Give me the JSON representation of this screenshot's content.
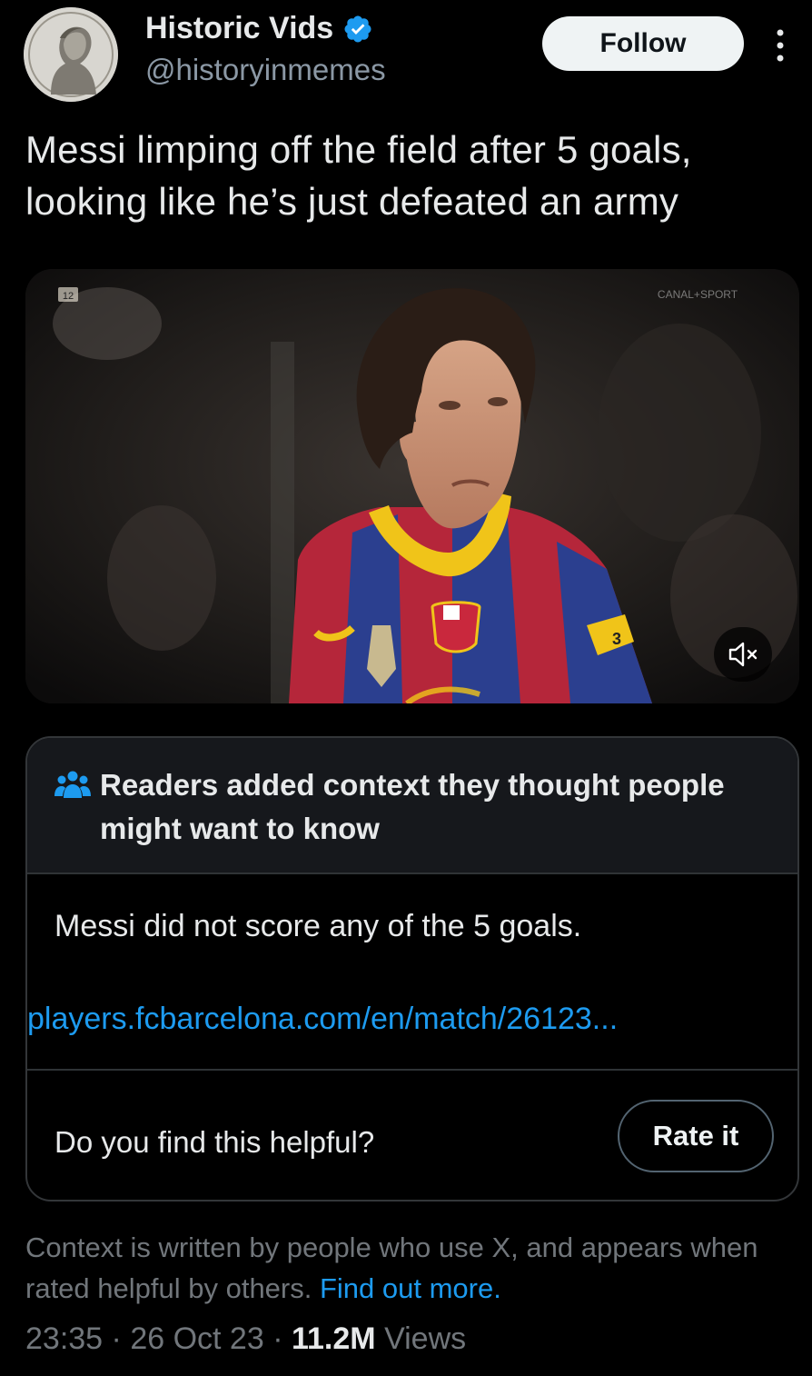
{
  "author": {
    "display_name": "Historic Vids",
    "handle": "@historyinmemes",
    "verified": true,
    "avatar_icon": "bust-portrait-avatar"
  },
  "actions": {
    "follow_label": "Follow",
    "more_icon": "more-vertical-icon"
  },
  "tweet": {
    "text_line1": "Messi limping off the field after 5 goals,",
    "text_line2": "looking like he’s just defeated an army"
  },
  "media": {
    "broadcast_label": "CANAL+SPORT",
    "corner_number": "12",
    "mute_icon": "speaker-muted-icon",
    "colors": {
      "shirt_red": "#b5263a",
      "shirt_blue": "#2b3f8f",
      "collar_yellow": "#f0c419"
    }
  },
  "community_note": {
    "title": "Readers added context they thought people might want to know",
    "body": "Messi did not score any of the 5 goals.",
    "link": "players.fcbarcelona.com/en/match/26123...",
    "helpful_question": "Do you find this helpful?",
    "rate_label": "Rate it",
    "icon": "people-group-icon"
  },
  "disclaimer": {
    "text": "Context is written by people who use X, and appears when rated helpful by others.",
    "link_text": "Find out more."
  },
  "meta": {
    "time": "23:35",
    "date": "26 Oct 23",
    "views_count": "11.2M",
    "views_label": "Views",
    "separator": "·"
  },
  "theme": {
    "accent": "#1d9bf0",
    "background": "#000000",
    "muted_text": "#71767b"
  }
}
